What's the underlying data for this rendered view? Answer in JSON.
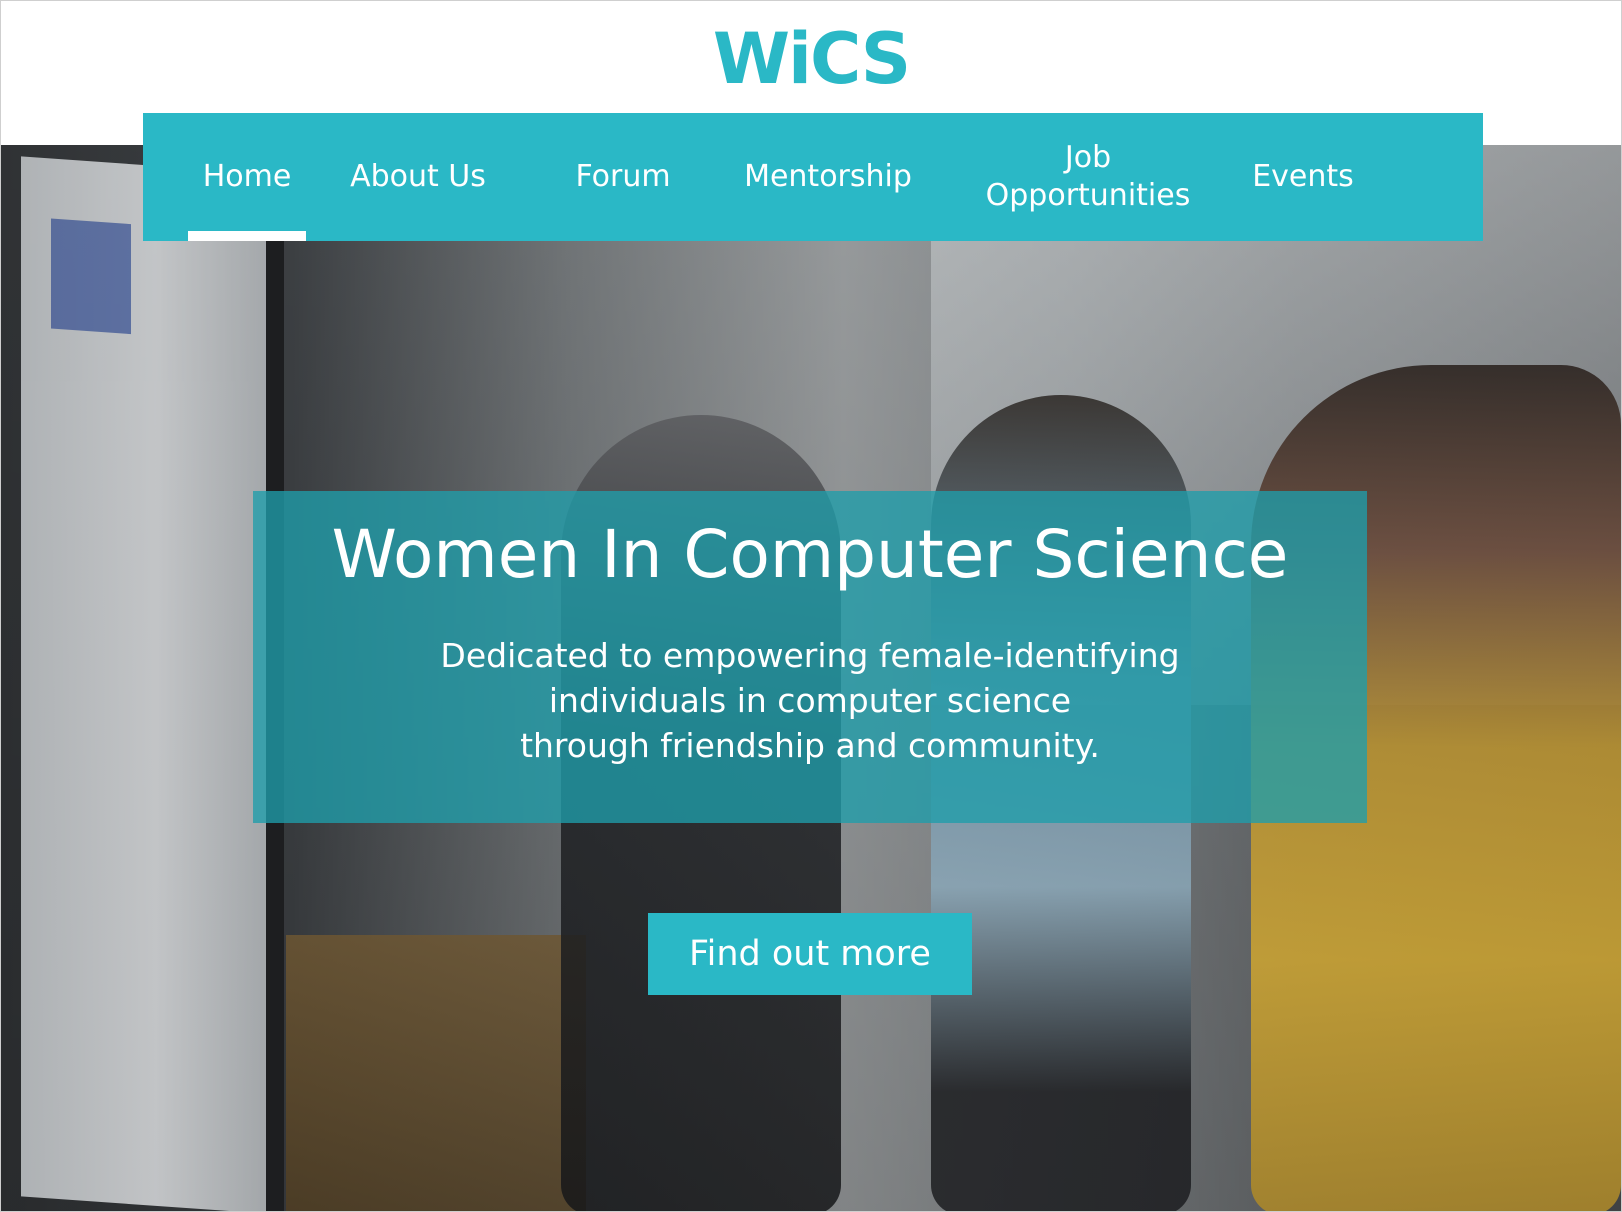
{
  "brand": {
    "logo_text": "WiCS",
    "accent_color": "#2ab8c6"
  },
  "nav": {
    "items": [
      {
        "label": "Home",
        "active": true
      },
      {
        "label": "About Us",
        "active": false
      },
      {
        "label": "Forum",
        "active": false
      },
      {
        "label": "Mentorship",
        "active": false
      },
      {
        "label": "Job Opportunities",
        "active": false
      },
      {
        "label": "Events",
        "active": false
      }
    ],
    "background_color": "#2ab8c6"
  },
  "hero": {
    "title": "Women In Computer Science",
    "subtitle_lines": [
      "Dedicated to empowering female-identifying",
      "individuals in computer science",
      "through friendship and community."
    ],
    "panel_color": "rgba(31, 158, 170, 0.78)",
    "cta_label": "Find out more",
    "cta_color": "#2ab8c6"
  }
}
